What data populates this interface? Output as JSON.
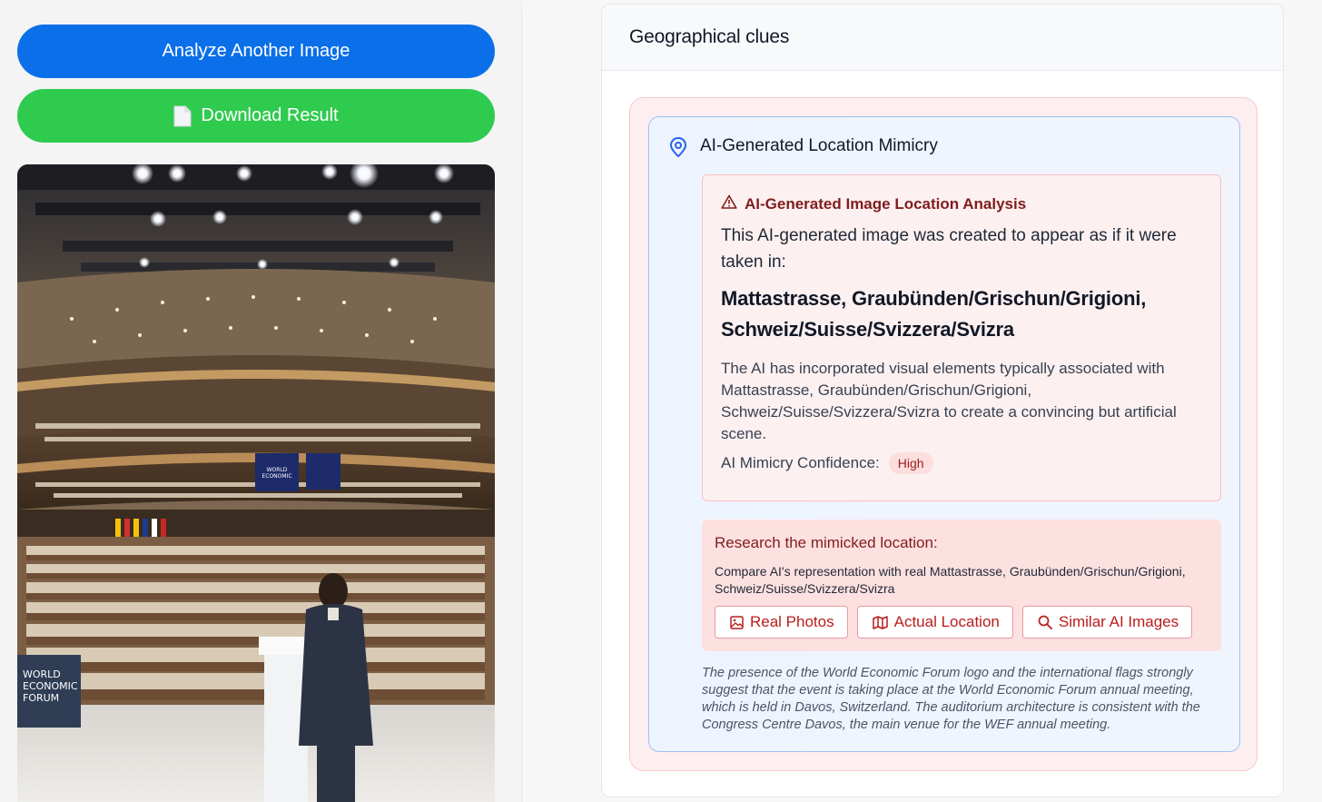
{
  "left": {
    "analyze_label": "Analyze Another Image",
    "download_label": "Download Result",
    "photo_logo_text": "WORLD ECONOMIC FORUM"
  },
  "panel": {
    "header_title": "Geographical clues",
    "mimicry": {
      "title": "AI-Generated Location Mimicry",
      "analysis_heading": "AI-Generated Image Location Analysis",
      "intro_text": "This AI-generated image was created to appear as if it were taken in:",
      "location": "Mattastrasse, Graubünden/Grischun/Grigioni, Schweiz/Suisse/Svizzera/Svizra",
      "description": "The AI has incorporated visual elements typically associated with Mattastrasse, Graubünden/Grischun/Grigioni, Schweiz/Suisse/Svizzera/Svizra to create a convincing but artificial scene.",
      "confidence_label": "AI Mimicry Confidence:",
      "confidence_value": "High"
    },
    "research": {
      "title": "Research the mimicked location:",
      "text": "Compare AI's representation with real Mattastrasse, Graubünden/Grischun/Grigioni, Schweiz/Suisse/Svizzera/Svizra",
      "links": [
        "Real Photos",
        "Actual Location",
        "Similar AI Images"
      ]
    },
    "note": "The presence of the World Economic Forum logo and the international flags strongly suggest that the event is taking place at the World Economic Forum annual meeting, which is held in Davos, Switzerland. The auditorium architecture is consistent with the Congress Centre Davos, the main venue for the WEF annual meeting."
  },
  "colors": {
    "analyze_button": "#0a6fe8",
    "download_button": "#2fcb4e",
    "accent_red": "#b91c1c",
    "accent_blue": "#9ec1ee"
  },
  "icons": [
    "document-icon",
    "map-pin-icon",
    "warning-icon",
    "image-icon",
    "map-icon",
    "search-icon"
  ]
}
